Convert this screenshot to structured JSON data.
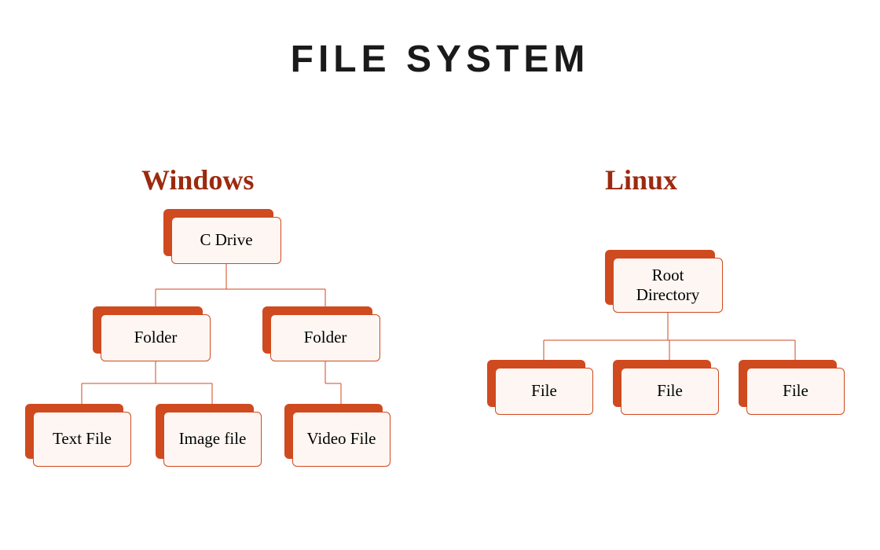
{
  "title": "FILE SYSTEM",
  "subtitles": {
    "windows": "Windows",
    "linux": "Linux"
  },
  "windows_tree": {
    "root": "C Drive",
    "folder1": "Folder",
    "folder2": "Folder",
    "text_file": "Text File",
    "image_file": "Image file",
    "video_file": "Video File"
  },
  "linux_tree": {
    "root": "Root Directory",
    "file1": "File",
    "file2": "File",
    "file3": "File"
  },
  "colors": {
    "accent": "#d04a1f",
    "heading": "#9c2a0f",
    "box_bg": "#fdf6f2"
  }
}
